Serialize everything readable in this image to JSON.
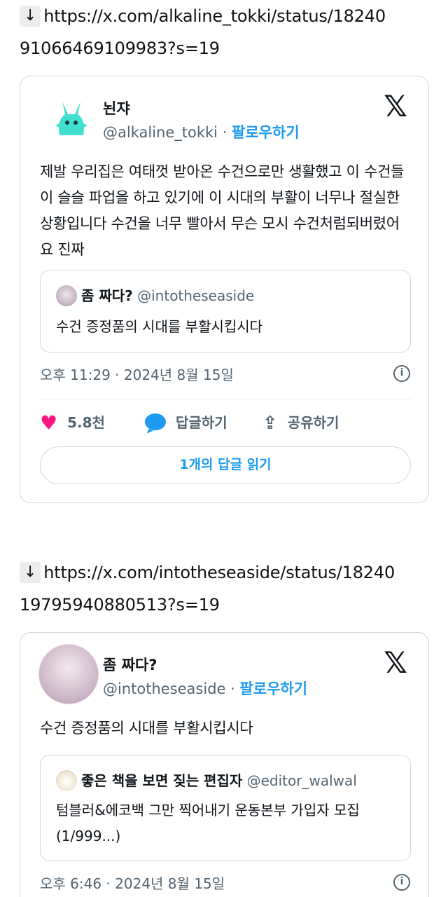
{
  "post1": {
    "link_arrow": "↓",
    "link_line1": "https://x.com/alkaline_tokki/status/18240",
    "link_line2": "91066469109983?s=19",
    "display_name": "뇐쟈",
    "handle": "@alkaline_tokki",
    "separator": " · ",
    "follow_label": "팔로우하기",
    "logo": "𝕏",
    "text": "제발 우리집은 여태껏 받아온 수건으로만 생활했고 이 수건들이 슬슬 파업을 하고 있기에 이 시대의 부활이 너무나 절실한 상황입니다 수건을 너무 빨아서 무슨 모시 수건처럼되버렸어요 진짜",
    "quote": {
      "name": "좀 짜다?",
      "handle": "@intotheseaside",
      "text": "수건 증정품의 시대를 부활시킵시다"
    },
    "timestamp": "오후 11:29 · 2024년 8월 15일",
    "info_icon": "i",
    "like_icon": "♥",
    "likes": "5.8천",
    "reply_label": "답글하기",
    "share_icon": "⇪",
    "share_label": "공유하기",
    "read_replies": "1개의 답글 읽기"
  },
  "post2": {
    "link_arrow": "↓",
    "link_line1": "https://x.com/intotheseaside/status/18240",
    "link_line2": "19795940880513?s=19",
    "display_name": "좀 짜다?",
    "handle": "@intotheseaside",
    "separator": " · ",
    "follow_label": "팔로우하기",
    "logo": "𝕏",
    "text": "수건 증정품의 시대를 부활시킵시다",
    "quote": {
      "name": "좋은 책을 보면 짖는 편집자",
      "handle": "@editor_walwal",
      "text": "텀블러&에코백 그만 찍어내기 운동본부 가입자 모집 (1/999...)"
    },
    "timestamp": "오후 6:46 · 2024년 8월 15일",
    "info_icon": "i"
  },
  "colors": {
    "accent": "#1d9bf0",
    "like": "#f91880",
    "border": "#cfd9de",
    "muted": "#536471"
  }
}
